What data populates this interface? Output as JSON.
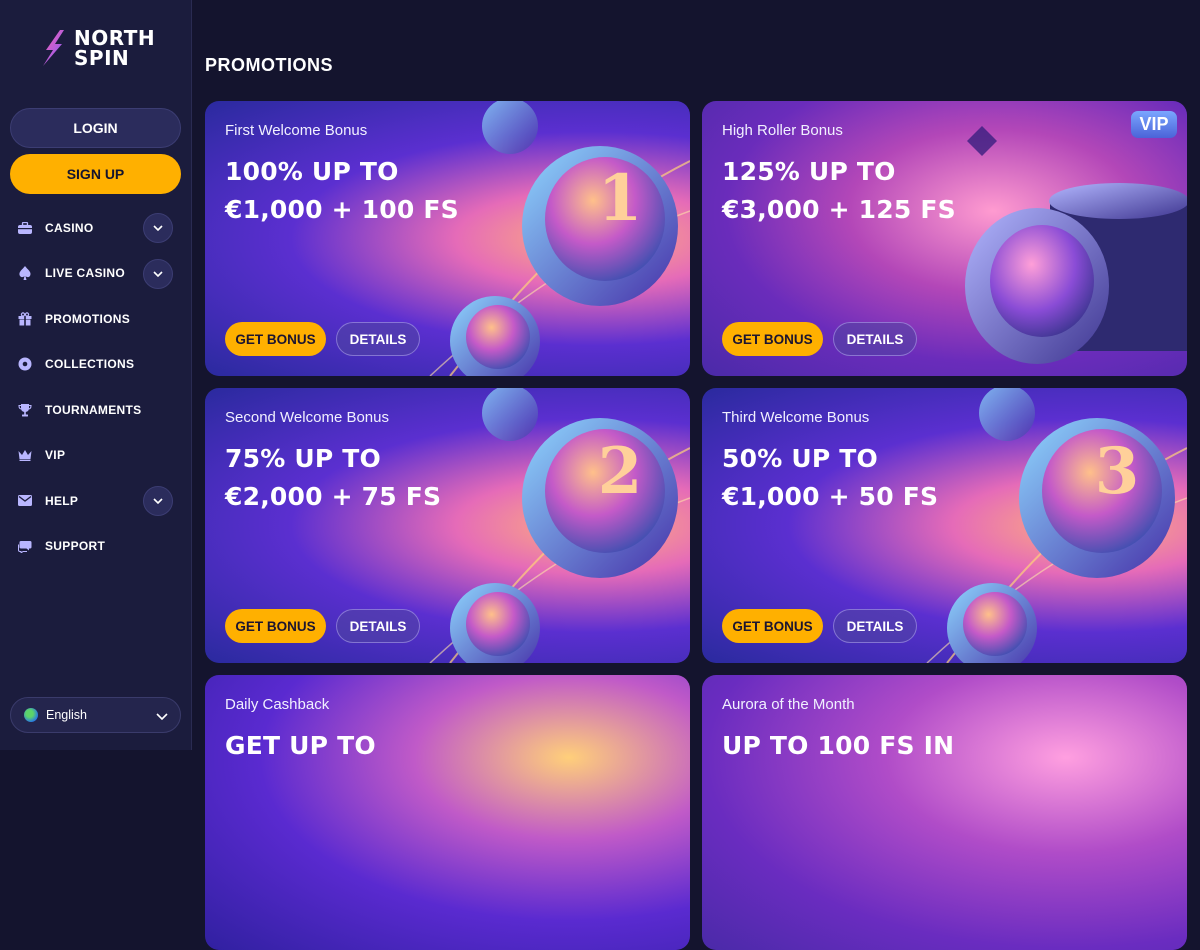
{
  "brand": {
    "line1": "NORTH",
    "line2": "SPIN"
  },
  "auth": {
    "login_label": "LOGIN",
    "signup_label": "SIGN UP"
  },
  "sidebar": {
    "items": [
      {
        "label": "CASINO",
        "icon": "briefcase-icon",
        "has_chevron": true
      },
      {
        "label": "LIVE CASINO",
        "icon": "spade-icon",
        "has_chevron": true
      },
      {
        "label": "PROMOTIONS",
        "icon": "gift-icon",
        "has_chevron": false
      },
      {
        "label": "COLLECTIONS",
        "icon": "collection-icon",
        "has_chevron": false
      },
      {
        "label": "TOURNAMENTS",
        "icon": "trophy-icon",
        "has_chevron": false
      },
      {
        "label": "VIP",
        "icon": "crown-icon",
        "has_chevron": false
      },
      {
        "label": "HELP",
        "icon": "mail-icon",
        "has_chevron": true
      },
      {
        "label": "SUPPORT",
        "icon": "chat-icon",
        "has_chevron": false
      }
    ]
  },
  "language": {
    "label": "English"
  },
  "main": {
    "title": "PROMOTIONS"
  },
  "promotions": [
    {
      "subtitle": "First Welcome Bonus",
      "headline": "100% UP TO\n€1,000 + 100 FS",
      "get_label": "GET BONUS",
      "details_label": "DETAILS",
      "coin_number": "1",
      "vip": ""
    },
    {
      "subtitle": "High Roller Bonus",
      "headline": "125% UP TO\n€3,000 + 125 FS",
      "get_label": "GET BONUS",
      "details_label": "DETAILS",
      "coin_number": "",
      "vip": "VIP"
    },
    {
      "subtitle": "Second Welcome Bonus",
      "headline": "75% UP TO\n€2,000 + 75 FS",
      "get_label": "GET BONUS",
      "details_label": "DETAILS",
      "coin_number": "2",
      "vip": ""
    },
    {
      "subtitle": "Third Welcome Bonus",
      "headline": "50% UP TO\n€1,000 + 50 FS",
      "get_label": "GET BONUS",
      "details_label": "DETAILS",
      "coin_number": "3",
      "vip": ""
    },
    {
      "subtitle": "Daily Cashback",
      "headline": "GET UP TO",
      "get_label": "",
      "details_label": "",
      "coin_number": "",
      "vip": ""
    },
    {
      "subtitle": "Aurora of the Month",
      "headline": "UP TO 100 FS IN",
      "get_label": "",
      "details_label": "",
      "coin_number": "",
      "vip": ""
    }
  ],
  "colors": {
    "accent": "#ffb000",
    "sidebar_bg": "#1b1c3d",
    "page_bg": "#14142e"
  }
}
